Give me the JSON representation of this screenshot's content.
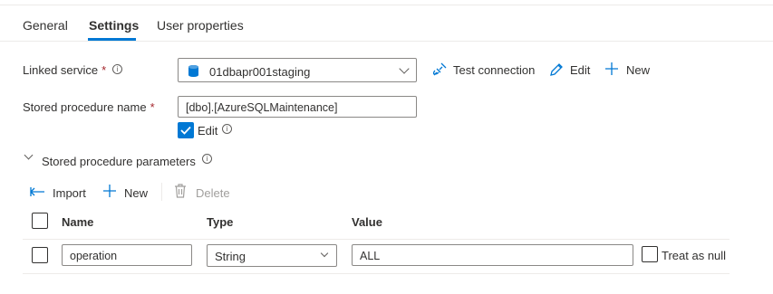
{
  "tabs": [
    {
      "label": "General"
    },
    {
      "label": "Settings"
    },
    {
      "label": "User properties"
    }
  ],
  "active_tab": "Settings",
  "linked_service": {
    "label": "Linked service",
    "required_mark": "*",
    "value": "01dbapr001staging",
    "test_connection_label": "Test connection",
    "edit_label": "Edit",
    "new_label": "New"
  },
  "stored_procedure": {
    "label": "Stored procedure name",
    "required_mark": "*",
    "value": "[dbo].[AzureSQLMaintenance]",
    "edit_checkbox_label": "Edit",
    "edit_checked": true
  },
  "parameters": {
    "section_label": "Stored procedure parameters",
    "import_label": "Import",
    "new_label": "New",
    "delete_label": "Delete",
    "columns": [
      "Name",
      "Type",
      "Value"
    ],
    "rows": [
      {
        "name": "operation",
        "type": "String",
        "value": "ALL",
        "null_label": "Treat as null",
        "null_checked": false
      }
    ]
  },
  "colors": {
    "accent": "#0078d4",
    "required": "#a4262c",
    "disabled": "#a19f9d"
  }
}
